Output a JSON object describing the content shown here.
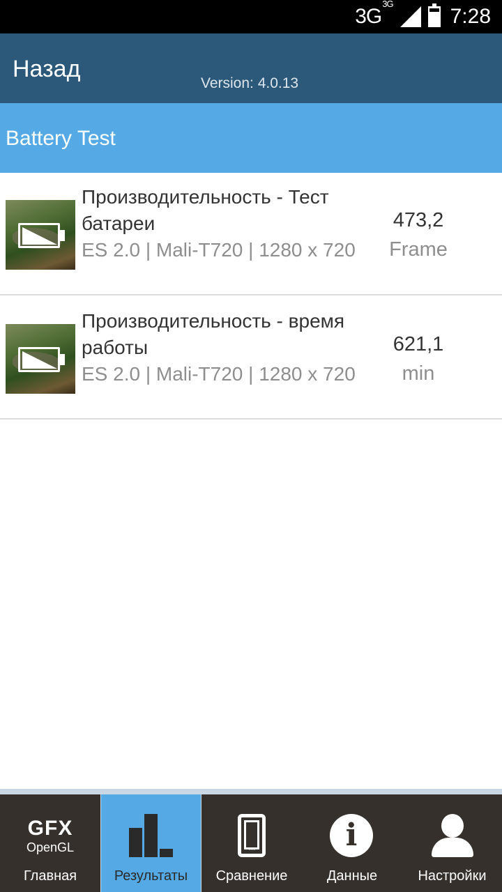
{
  "status_bar": {
    "network_type": "3G",
    "network_sub": "3G",
    "time": "7:28"
  },
  "header": {
    "back_label": "Назад",
    "version": "Version: 4.0.13"
  },
  "section": {
    "title": "Battery Test"
  },
  "results": [
    {
      "title": "Производительность - Тест батареи",
      "subtitle": "ES 2.0 | Mali-T720 | 1280 x 720",
      "value": "473,2",
      "unit": "Frame",
      "icon": "battery-test-thumbnail"
    },
    {
      "title": "Производительность - время работы",
      "subtitle": "ES 2.0 | Mali-T720 | 1280 x 720",
      "value": "621,1",
      "unit": "min",
      "icon": "battery-test-thumbnail"
    }
  ],
  "bottom_nav": {
    "logo_main": "GFX",
    "logo_sub": "OpenGL",
    "items": [
      {
        "label": "Главная",
        "icon": "gfx-logo-icon",
        "active": false
      },
      {
        "label": "Результаты",
        "icon": "bar-chart-icon",
        "active": true
      },
      {
        "label": "Сравнение",
        "icon": "phone-icon",
        "active": false
      },
      {
        "label": "Данные",
        "icon": "info-icon",
        "active": false
      },
      {
        "label": "Настройки",
        "icon": "user-icon",
        "active": false
      }
    ]
  },
  "colors": {
    "header": "#2c5879",
    "section": "#55aae6",
    "nav_background": "#35302b",
    "nav_active": "#55aae6"
  }
}
